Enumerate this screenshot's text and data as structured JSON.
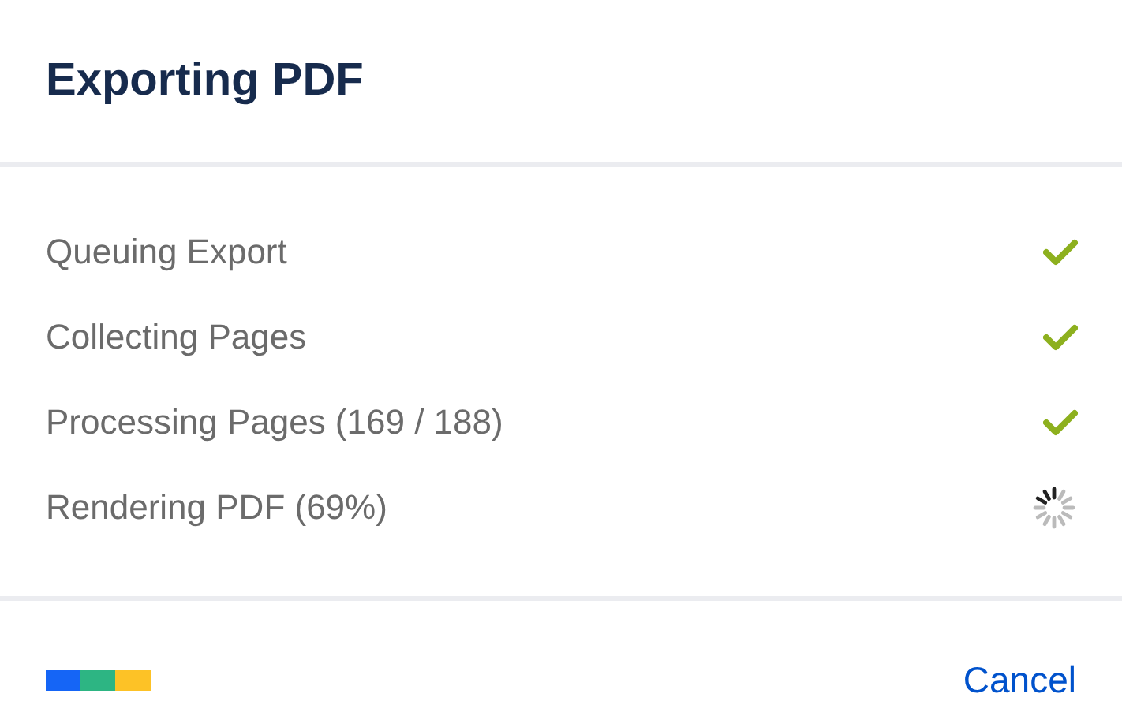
{
  "dialog": {
    "title": "Exporting PDF"
  },
  "steps": [
    {
      "label": "Queuing Export",
      "complete": true
    },
    {
      "label": "Collecting Pages",
      "complete": true
    },
    {
      "label": "Processing Pages (169 / 188)",
      "complete": true
    },
    {
      "label": "Rendering PDF (69%)",
      "complete": false
    }
  ],
  "footer": {
    "cancel": "Cancel"
  }
}
